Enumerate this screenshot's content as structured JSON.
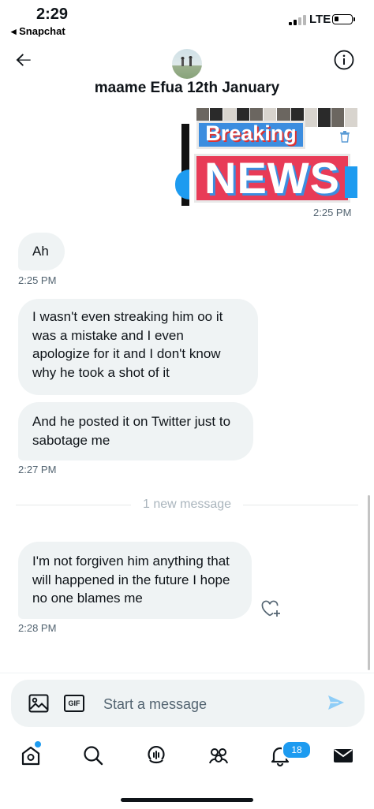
{
  "status_bar": {
    "time": "2:29",
    "back_app": "◂ Snapchat",
    "network": "LTE"
  },
  "header": {
    "title": "maame Efua 12th January"
  },
  "media": {
    "breaking_text": "Breaking",
    "news_text": "NEWS",
    "timestamp": "2:25 PM"
  },
  "messages": [
    {
      "text": "Ah",
      "timestamp": "2:25 PM"
    },
    {
      "text": "I wasn't even streaking him oo it was a mistake and I even apologize for it and I don't know why he took a shot of it"
    },
    {
      "text": "And he posted it on Twitter just to sabotage me",
      "timestamp": "2:27 PM"
    },
    {
      "text": "I'm not forgiven him anything that will happened in the future I hope no one blames me",
      "timestamp": "2:28 PM"
    }
  ],
  "divider": {
    "label": "1 new message"
  },
  "composer": {
    "gif_label": "GIF",
    "placeholder": "Start a message"
  },
  "tabbar": {
    "notifications_count": "18"
  },
  "colors": {
    "accent": "#1d9bf0",
    "bubble": "#eff3f4",
    "muted_text": "#536471"
  },
  "icons": [
    "back-arrow-icon",
    "info-icon",
    "trash-icon",
    "add-reaction-icon",
    "image-icon",
    "gif-icon",
    "send-icon",
    "home-icon",
    "search-icon",
    "spaces-icon",
    "communities-icon",
    "notifications-icon",
    "messages-icon"
  ]
}
